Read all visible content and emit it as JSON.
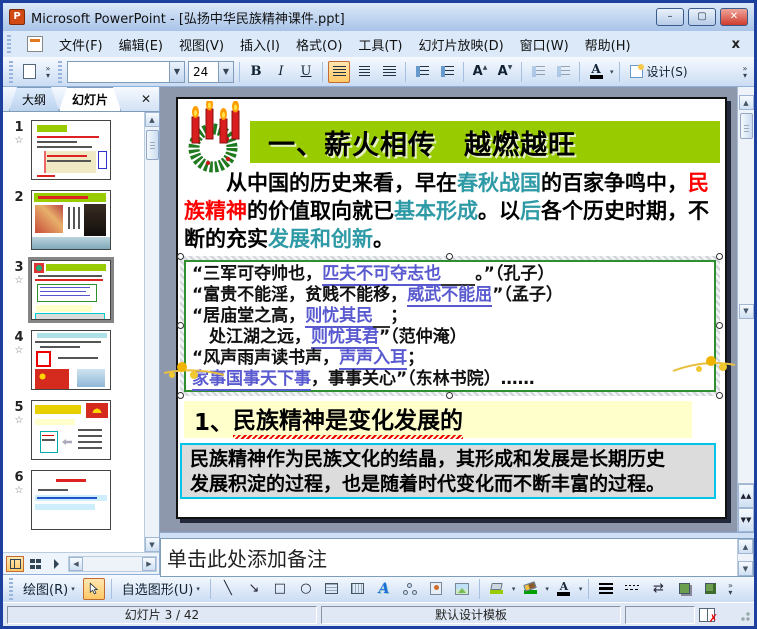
{
  "window": {
    "title": "Microsoft PowerPoint - [弘扬中华民族精神课件.ppt]"
  },
  "colors": {
    "title_bar_green": "#99CC00",
    "teal_text": "#2E9AA6",
    "red_text": "#FF0000",
    "answer_blue": "#5A5AD0",
    "quote_border_green": "#2F8F2F",
    "subtitle_bg_yellow": "#FFFFCC",
    "summary_bg_gray": "#DCDCDC",
    "summary_border_cyan": "#00C4E8",
    "selection_highlight_orange": "#FFC966"
  },
  "icons": {
    "star": "☆",
    "app_p": "P",
    "min": "–",
    "max": "▢",
    "close_x": "✕",
    "menu_close": "x",
    "dropdown": "▼",
    "caret": "▾",
    "overflow": "»",
    "up": "▲",
    "down": "▼",
    "left": "◀",
    "right": "▶",
    "double_up": "▲▲",
    "double_down": "▼▼",
    "line": "╲",
    "arrow": "↘",
    "rect": "□",
    "oval": "○",
    "swap": "⇄",
    "font_a": "A",
    "x_mark": "✗",
    "wordart_a": "A"
  },
  "menu": {
    "items": [
      "文件(F)",
      "编辑(E)",
      "视图(V)",
      "插入(I)",
      "格式(O)",
      "工具(T)",
      "幻灯片放映(D)",
      "窗口(W)",
      "帮助(H)"
    ]
  },
  "toolbar": {
    "font_name": "",
    "font_size": "24",
    "bold": "B",
    "italic": "I",
    "underline": "U",
    "design": "设计(S)"
  },
  "pane": {
    "tabs": {
      "outline": "大纲",
      "slides": "幻灯片"
    },
    "slides": [
      {
        "n": "1",
        "star": "☆"
      },
      {
        "n": "2",
        "star": ""
      },
      {
        "n": "3",
        "star": "☆"
      },
      {
        "n": "4",
        "star": "☆"
      },
      {
        "n": "5",
        "star": "☆"
      },
      {
        "n": "6",
        "star": "☆"
      }
    ]
  },
  "slide": {
    "title": "一、薪火相传　越燃越旺",
    "body": {
      "s1": "从中国的历史来看，早在",
      "s2": "春秋战国",
      "s3": "的百家争鸣中，",
      "s4": "民族精神",
      "s5": "的价值取向就已",
      "s6": "基本形成",
      "s7": "。以",
      "s8": "后",
      "s9": "各个历史时期，不断的充实",
      "s10": "发展和创新",
      "s11": "。"
    },
    "quote": {
      "lines": [
        {
          "pre": "“三军可夺帅也，",
          "ans": "匹夫不可夺志也",
          "gap": "　　",
          "tail": "。”（孔子）"
        },
        {
          "pre": "“富贵不能淫，贫贱不能移，",
          "ans": "威武不能屈",
          "gap": "",
          "tail": "”（孟子）"
        },
        {
          "pre": "“居庙堂之高，",
          "ans": "则忧其民",
          "gap": "　",
          "tail": "；"
        },
        {
          "pre": "　处江湖之远，",
          "ans": "则忧其君",
          "gap": "",
          "tail": "”（范仲淹）"
        },
        {
          "pre": "“风声雨声读书声，",
          "ans": "声声入耳",
          "gap": "",
          "tail": "；"
        },
        {
          "pre": "",
          "ans": "家事国事天下事",
          "gap": "",
          "tail": "，事事关心”（东林书院）……"
        }
      ]
    },
    "subtitle": {
      "num": "1、",
      "text": "民族精神是变化发展的"
    },
    "summary": {
      "l1": "民族精神作为民族文化的结晶，其形成和发展是长期历史",
      "l2": "发展积淀的过程，也是随着时代变化而不断丰富的过程。"
    }
  },
  "notes": {
    "placeholder": "单击此处添加备注"
  },
  "drawbar": {
    "draw": "绘图(R)",
    "autoshapes": "自选图形(U)"
  },
  "status": {
    "slide_indicator": "幻灯片 3 / 42",
    "template": "默认设计模板"
  }
}
